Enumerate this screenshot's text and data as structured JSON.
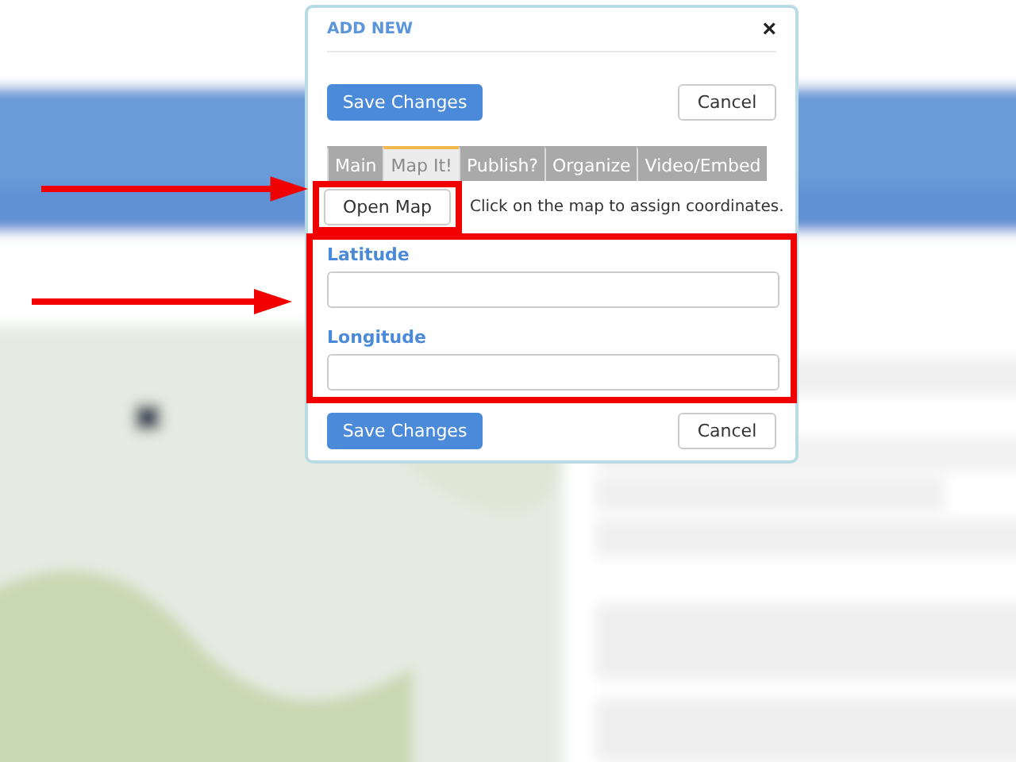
{
  "dialog": {
    "title": "ADD NEW",
    "close": "×",
    "top_buttons": [
      {
        "label": "Save Changes",
        "kind": "primary"
      },
      {
        "label": "Cancel",
        "kind": "default"
      }
    ],
    "tabs": [
      {
        "label": "Main",
        "selected": false
      },
      {
        "label": "Map It!",
        "selected": true
      },
      {
        "label": "Publish?",
        "selected": false
      },
      {
        "label": "Organize",
        "selected": false
      },
      {
        "label": "Video/Embed",
        "selected": false
      }
    ],
    "map_button": "Open Map",
    "map_hint": "Click on the map to assign coordinates.",
    "fields": [
      {
        "label": "Latitude"
      },
      {
        "label": "Longitude"
      }
    ],
    "bottom_buttons": [
      {
        "label": "Save Changes",
        "kind": "primary"
      },
      {
        "label": "Cancel",
        "kind": "default"
      }
    ]
  }
}
